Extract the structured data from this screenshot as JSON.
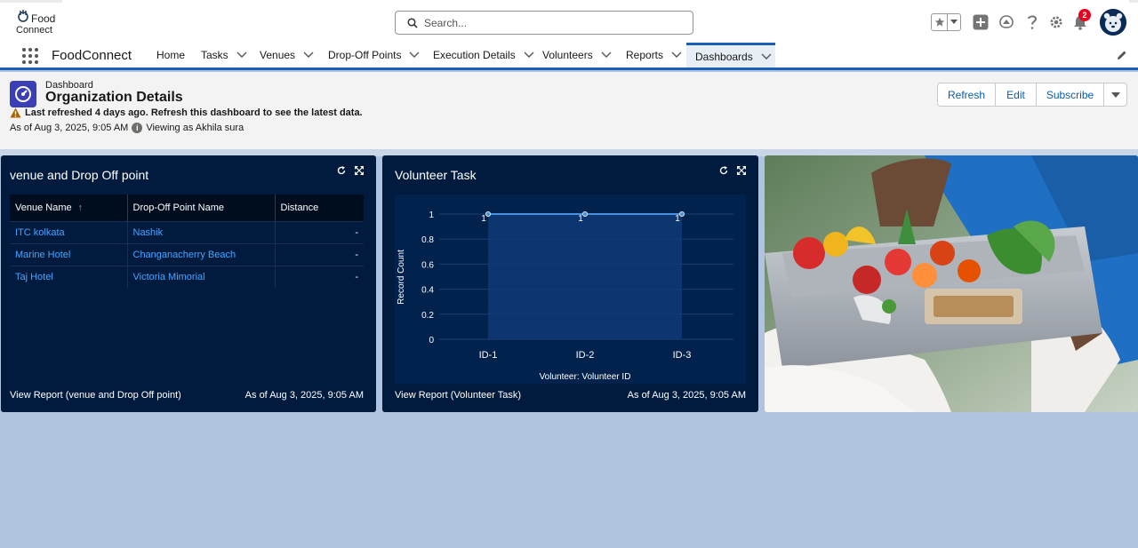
{
  "header": {
    "logo_line1": "Food",
    "logo_line2": "Connect",
    "search_placeholder": "Search...",
    "notifications_count": "2"
  },
  "nav": {
    "app_name": "FoodConnect",
    "tabs": [
      {
        "label": "Home"
      },
      {
        "label": "Tasks"
      },
      {
        "label": "Venues"
      },
      {
        "label": "Drop-Off Points"
      },
      {
        "label": "Execution Details"
      },
      {
        "label": "Volunteers"
      },
      {
        "label": "Reports"
      },
      {
        "label": "Dashboards"
      }
    ],
    "active_tab": "Dashboards"
  },
  "page": {
    "type_label": "Dashboard",
    "title": "Organization Details",
    "warning": "Last refreshed 4 days ago. Refresh this dashboard to see the latest data.",
    "as_of": "As of Aug 3, 2025, 9:05 AM",
    "viewing_as": "Viewing as Akhila sura",
    "buttons": {
      "refresh": "Refresh",
      "edit": "Edit",
      "subscribe": "Subscribe"
    }
  },
  "widgets": {
    "venue": {
      "title": "venue and Drop Off point",
      "columns": [
        "Venue Name",
        "Drop-Off Point Name",
        "Distance"
      ],
      "sort_indicator": "↑",
      "rows": [
        {
          "venue": "ITC kolkata",
          "dropoff": "Nashik",
          "distance": "-"
        },
        {
          "venue": "Marine Hotel",
          "dropoff": "Changanacherry Beach",
          "distance": "-"
        },
        {
          "venue": "Taj Hotel",
          "dropoff": "Victoria Mimorial",
          "distance": "-"
        }
      ],
      "footer_link": "View Report (venue and Drop Off point)",
      "footer_asof": "As of Aug 3, 2025, 9:05 AM"
    },
    "volunteer": {
      "title": "Volunteer Task",
      "footer_link": "View Report (Volunteer Task)",
      "footer_asof": "As of Aug 3, 2025, 9:05 AM"
    }
  },
  "chart_data": {
    "type": "area",
    "categories": [
      "ID-1",
      "ID-2",
      "ID-3"
    ],
    "values": [
      1,
      1,
      1
    ],
    "data_labels": [
      "1",
      "1",
      "1"
    ],
    "xlabel": "Volunteer: Volunteer ID",
    "ylabel": "Record Count",
    "ylim": [
      0,
      1
    ],
    "yticks": [
      "0",
      "0.2",
      "0.4",
      "0.6",
      "0.8",
      "1"
    ],
    "colors": {
      "line": "#4a90e2",
      "fill": "#0f3a78",
      "plot_bg": "#00224d"
    }
  }
}
